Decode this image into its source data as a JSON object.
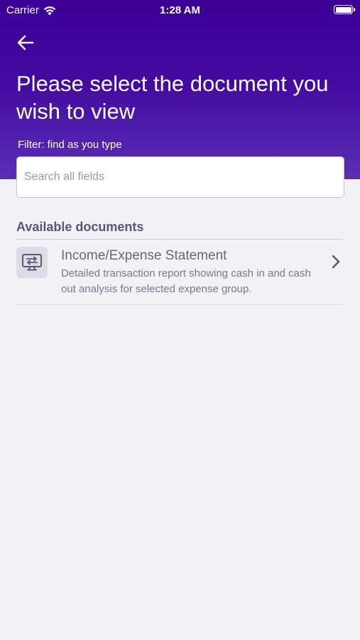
{
  "status_bar": {
    "carrier": "Carrier",
    "time": "1:28 AM"
  },
  "header": {
    "title": "Please select the document you wish to view",
    "filter_label": "Filter: find as you type"
  },
  "search": {
    "placeholder": "Search all fields",
    "value": ""
  },
  "documents": {
    "section_title": "Available documents",
    "items": [
      {
        "title": "Income/Expense Statement",
        "description": "Detailed transaction report showing cash in and cash out analysis for selected expense group.",
        "icon": "transfer-monitor-icon"
      }
    ]
  },
  "colors": {
    "header_top": "#3c0095",
    "header_bottom": "#5a2fb4",
    "background": "#f2f1f6",
    "section_title": "#5a5478"
  }
}
